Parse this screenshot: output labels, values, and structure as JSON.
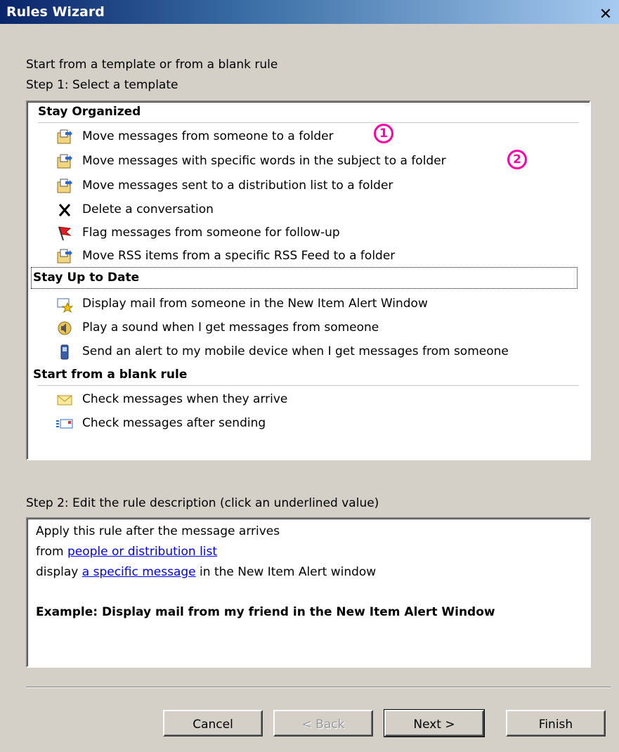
{
  "window": {
    "title": "Rules Wizard",
    "close_glyph": "✕"
  },
  "intro": "Start from a template or from a blank rule",
  "step1_label": "Step 1: Select a template",
  "groups": [
    {
      "name": "Stay Organized",
      "items": [
        {
          "icon": "move-to-folder-icon",
          "label": "Move messages from someone to a folder"
        },
        {
          "icon": "move-to-folder-icon",
          "label": "Move messages with specific words in the subject to a folder"
        },
        {
          "icon": "move-to-folder-icon",
          "label": "Move messages sent to a distribution list to a folder"
        },
        {
          "icon": "delete-x-icon",
          "label": "Delete a conversation"
        },
        {
          "icon": "red-flag-icon",
          "label": "Flag messages from someone for follow-up"
        },
        {
          "icon": "move-to-folder-icon",
          "label": "Move RSS items from a specific RSS Feed to a folder"
        }
      ]
    },
    {
      "name": "Stay Up to Date",
      "items": [
        {
          "icon": "new-item-alert-icon",
          "label": "Display mail from someone in the New Item Alert Window"
        },
        {
          "icon": "speaker-sound-icon",
          "label": "Play a sound when I get messages from someone"
        },
        {
          "icon": "mobile-device-icon",
          "label": "Send an alert to my mobile device when I get messages from someone"
        }
      ]
    },
    {
      "name": "Start from a blank rule",
      "items": [
        {
          "icon": "envelope-icon",
          "label": "Check messages when they arrive"
        },
        {
          "icon": "sent-message-icon",
          "label": "Check messages after sending"
        }
      ]
    }
  ],
  "callouts": [
    "1",
    "2"
  ],
  "step2_label": "Step 2: Edit the rule description (click an underlined value)",
  "description": {
    "line1": "Apply this rule after the message arrives",
    "line2_prefix": "from ",
    "line2_link": "people or distribution list",
    "line3_prefix": "display ",
    "line3_link": "a specific message",
    "line3_suffix": " in the New Item Alert window",
    "example": "Example: Display mail from my friend in the New Item Alert Window"
  },
  "buttons": {
    "cancel": "Cancel",
    "back": "< Back",
    "next": "Next >",
    "finish": "Finish"
  },
  "colors": {
    "titlebar_start": "#0a246a",
    "titlebar_end": "#a6caf0",
    "dialog_bg": "#d4d0c8",
    "link": "#0000ee",
    "callout": "#ff00aa"
  }
}
